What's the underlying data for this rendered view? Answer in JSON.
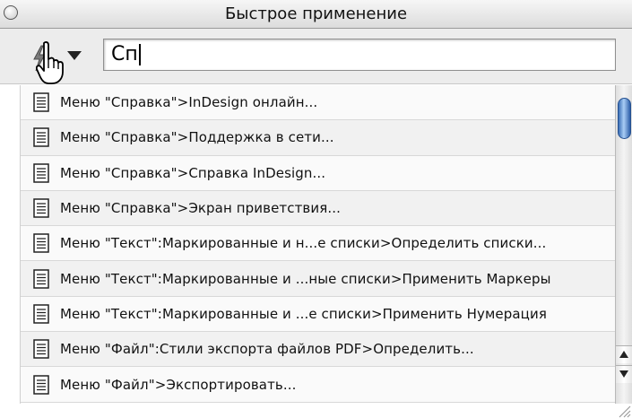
{
  "window": {
    "title": "Быстрое применение"
  },
  "search": {
    "value": "Сп"
  },
  "icons": {
    "close": "close-button",
    "action": "lightning-bolt-icon",
    "dropdown": "dropdown-arrow-icon",
    "cursor": "hand-pointer-icon",
    "item": "document-icon",
    "scroll_up": "scroll-up-arrow-icon",
    "scroll_down": "scroll-down-arrow-icon",
    "resize": "resize-grip-icon"
  },
  "colors": {
    "scroll_thumb": "#3b6fb6",
    "row_even": "#f1f1f1",
    "row_odd": "#fafafa"
  },
  "results": [
    "Меню \"Справка\">InDesign онлайн...",
    "Меню \"Справка\">Поддержка в сети...",
    "Меню \"Справка\">Справка InDesign...",
    "Меню \"Справка\">Экран приветствия...",
    "Меню \"Текст\":Маркированные и н...е списки>Определить списки...",
    "Меню \"Текст\":Маркированные и ...ные списки>Применить Маркеры",
    "Меню \"Текст\":Маркированные и ...е списки>Применить Нумерация",
    "Меню \"Файл\":Стили экспорта файлов PDF>Определить...",
    "Меню \"Файл\">Экспортировать..."
  ]
}
